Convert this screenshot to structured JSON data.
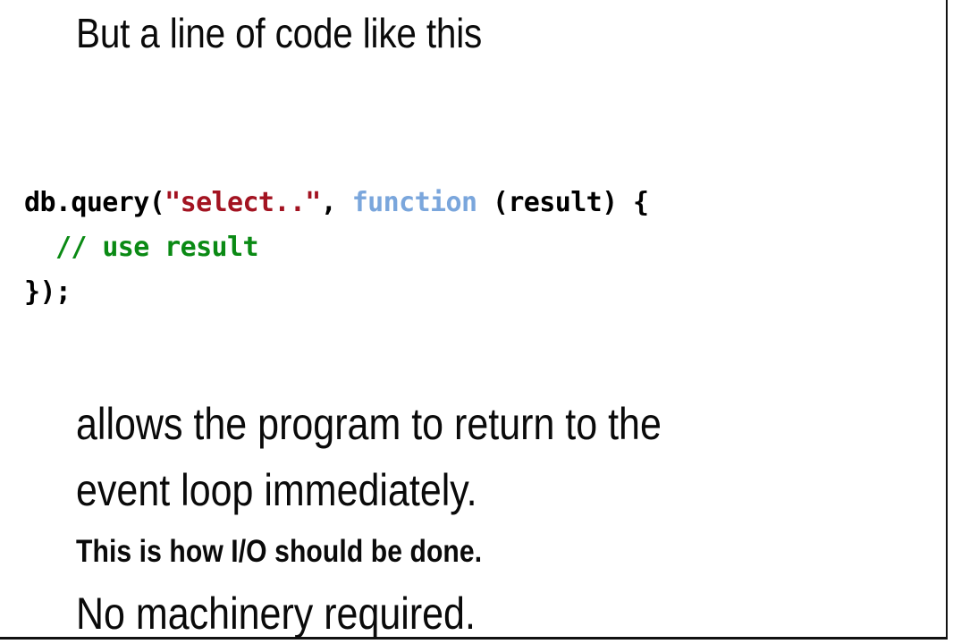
{
  "slide": {
    "background_color": "#ffffff",
    "rule_color": "#111111",
    "headline": "But a line of code like this",
    "code_block": {
      "language": "javascript",
      "colors": {
        "plain": "#000000",
        "string": "#a31321",
        "keyword": "#7aa6dc",
        "comment": "#0a8a14"
      },
      "lines": [
        {
          "tokens": [
            {
              "text": "db.query(",
              "type": "plain"
            },
            {
              "text": "\"select..\"",
              "type": "string"
            },
            {
              "text": ", ",
              "type": "plain"
            },
            {
              "text": "function",
              "type": "keyword"
            },
            {
              "text": " (result) {",
              "type": "plain"
            }
          ]
        },
        {
          "tokens": [
            {
              "text": "  ",
              "type": "plain"
            },
            {
              "text": "// use result",
              "type": "comment"
            }
          ]
        },
        {
          "tokens": [
            {
              "text": "});",
              "type": "plain"
            }
          ]
        }
      ],
      "plain_text": "db.query(\"select..\", function (result) {\n  // use result\n});"
    },
    "body_lines": [
      {
        "text": "allows the program to return to the",
        "emphasis": false
      },
      {
        "text": "event loop immediately.",
        "emphasis": false
      },
      {
        "text": "This is how I/O should be done.",
        "emphasis": true
      },
      {
        "text": "No machinery required.",
        "emphasis": false
      }
    ]
  }
}
